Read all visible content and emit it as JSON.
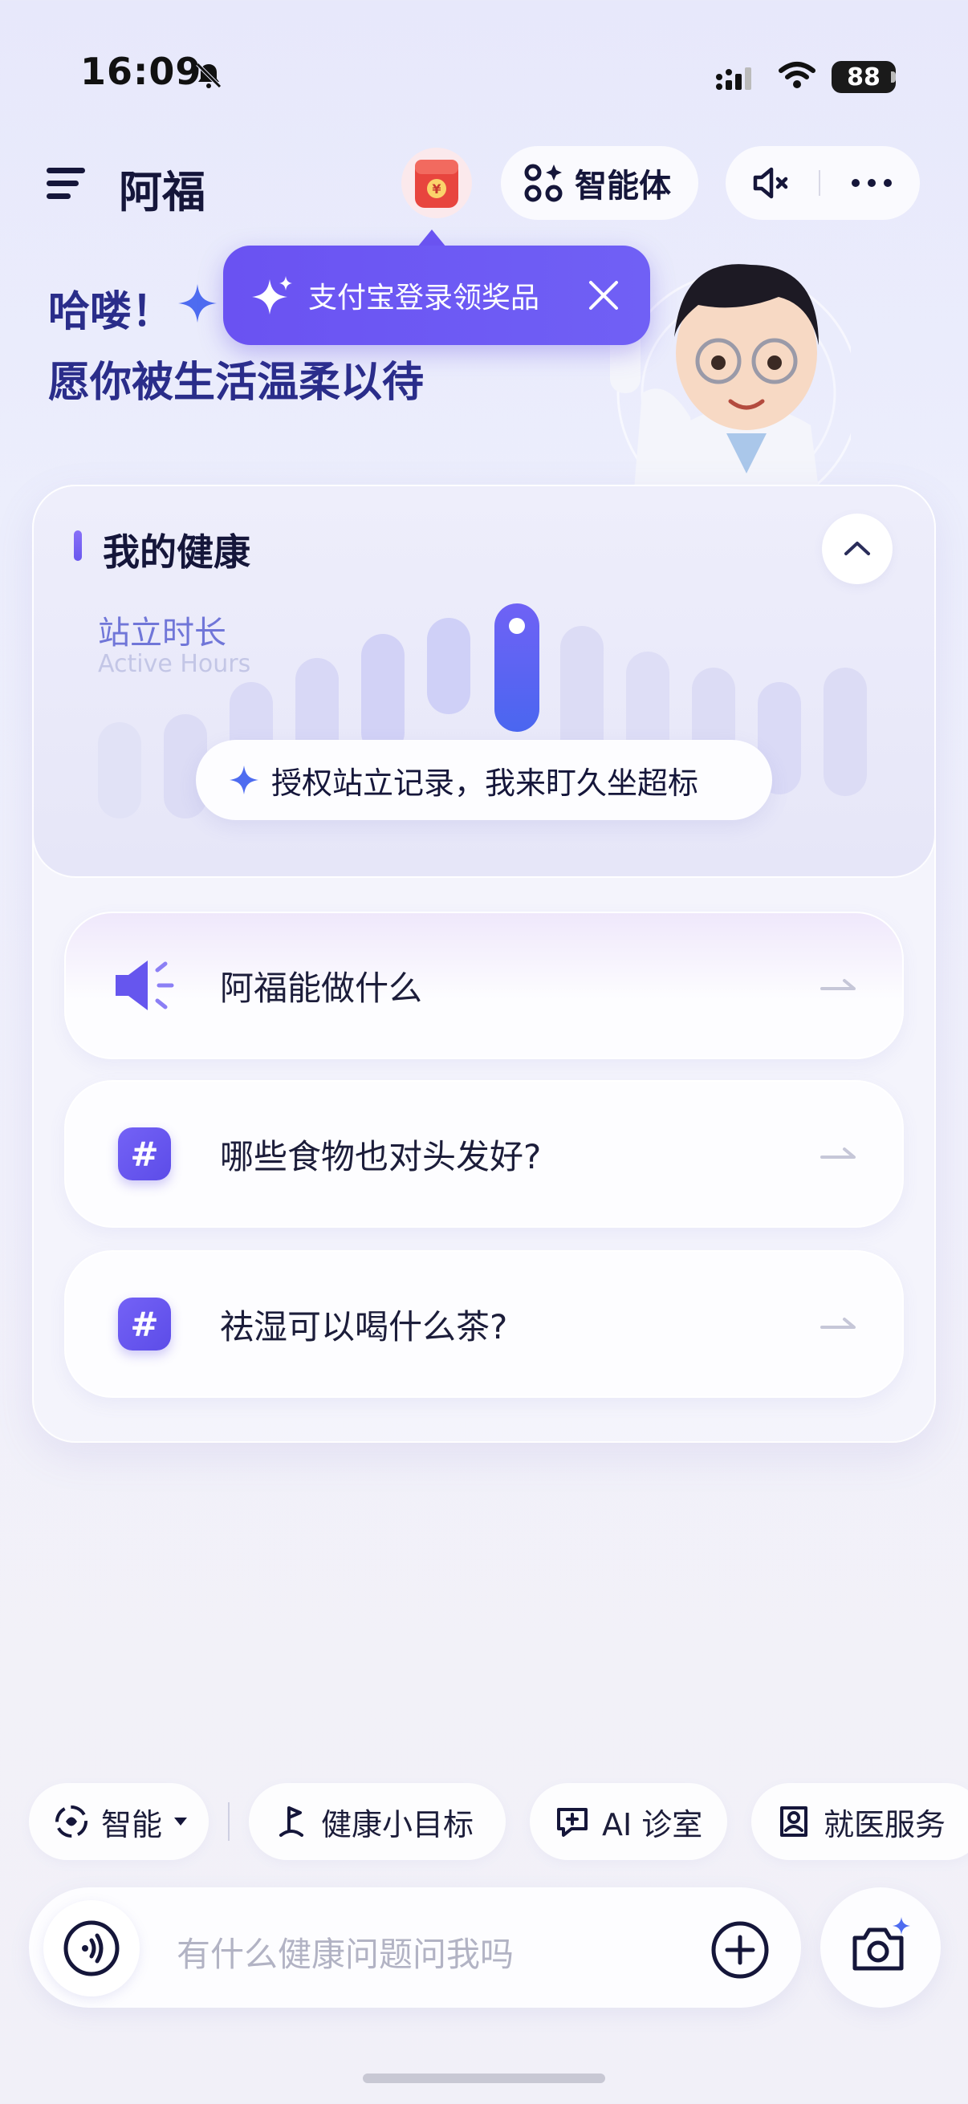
{
  "status_bar": {
    "time": "16:09",
    "battery": "88"
  },
  "header": {
    "title": "阿福",
    "agent_label": "智能体"
  },
  "tooltip": {
    "text": "支付宝登录领奖品"
  },
  "greeting": {
    "line1": "哈喽！",
    "line2": "愿你被生活温柔以待"
  },
  "health_card": {
    "title": "我的健康",
    "metric_title": "站立时长",
    "metric_subtitle": "Active Hours",
    "authorize_text": "授权站立记录，我来盯久坐超标"
  },
  "suggestions": [
    {
      "icon": "speaker-icon",
      "text": "阿福能做什么"
    },
    {
      "icon": "hashtag-icon",
      "text": "哪些食物也对头发好?"
    },
    {
      "icon": "hashtag-icon",
      "text": "祛湿可以喝什么茶?"
    }
  ],
  "chips": {
    "mode": "智能",
    "goal": "健康小目标",
    "ai_clinic": "AI 诊室",
    "medical_service": "就医服务"
  },
  "input": {
    "placeholder": "有什么健康问题问我吗"
  },
  "colors": {
    "accent": "#6a52f2",
    "title": "#2a2d8a"
  }
}
